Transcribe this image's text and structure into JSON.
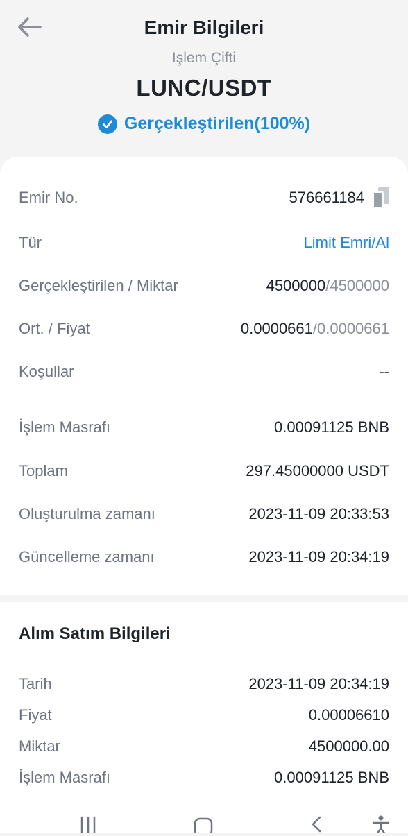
{
  "header": {
    "title": "Emir Bilgileri",
    "pair_label": "Işlem Çifti",
    "pair": "LUNC/USDT",
    "status": "Gerçekleştirilen(100%)"
  },
  "order": {
    "order_no_label": "Emir No.",
    "order_no": "576661184",
    "type_label": "Tür",
    "type_value": "Limit Emri/Al",
    "filled_label": "Gerçekleştirilen / Miktar",
    "filled_value": "4500000",
    "amount_value": "/4500000",
    "avg_label": "Ort. / Fiyat",
    "avg_value": "0.0000661",
    "price_value": "/0.0000661",
    "conditions_label": "Koşullar",
    "conditions_value": "--",
    "fee_label": "İşlem Masrafı",
    "fee_value": "0.00091125 BNB",
    "total_label": "Toplam",
    "total_value": "297.45000000 USDT",
    "created_label": "Oluşturulma zamanı",
    "created_value": "2023-11-09 20:33:53",
    "updated_label": "Güncelleme zamanı",
    "updated_value": "2023-11-09 20:34:19"
  },
  "trade": {
    "section_title": "Alım Satım Bilgileri",
    "date_label": "Tarih",
    "date_value": "2023-11-09 20:34:19",
    "price_label": "Fiyat",
    "price_value": "0.00006610",
    "qty_label": "Miktar",
    "qty_value": "4500000.00",
    "fee_label": "İşlem Masrafı",
    "fee_value": "0.00091125 BNB"
  },
  "icons": {
    "back": "arrow-left-icon",
    "status": "check-circle-icon",
    "copy": "copy-icon",
    "nav": [
      "recent-apps-icon",
      "home-icon",
      "back-chevron-icon",
      "accessibility-icon"
    ]
  },
  "colors": {
    "accent": "#1f8bd6",
    "text": "#1e2329",
    "muted": "#8a8f98",
    "background": "#f4f4f5"
  }
}
